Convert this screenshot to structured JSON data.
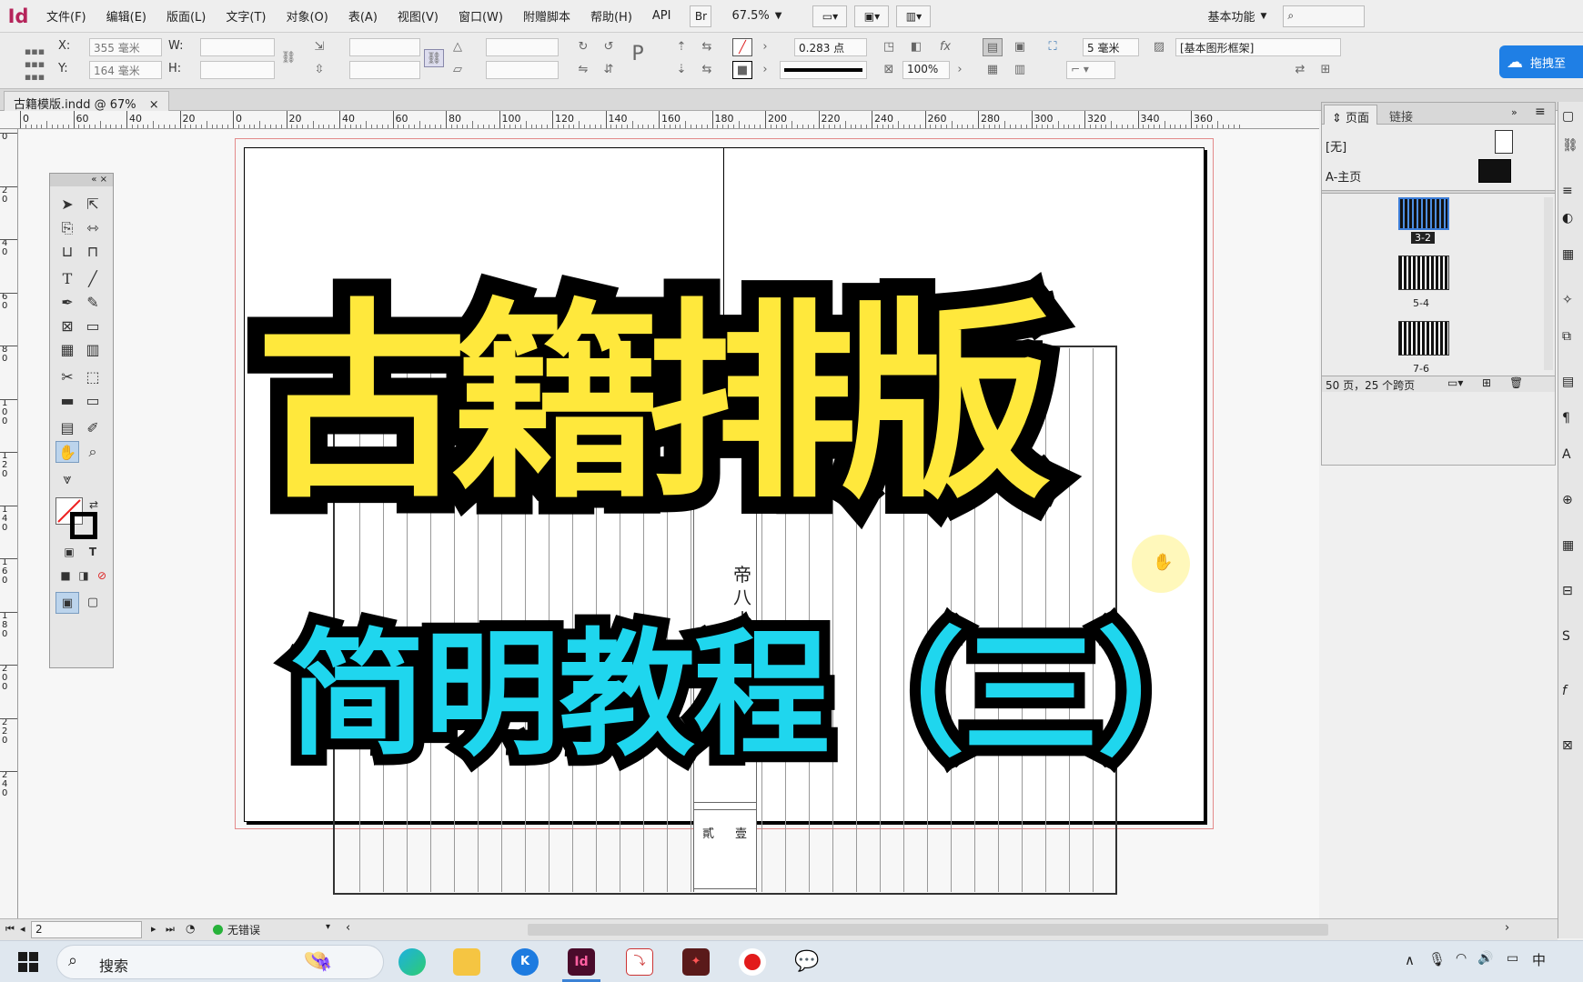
{
  "app": {
    "logo": "Id"
  },
  "menu": [
    "文件(F)",
    "编辑(E)",
    "版面(L)",
    "文字(T)",
    "对象(O)",
    "表(A)",
    "视图(V)",
    "窗口(W)",
    "附赠脚本",
    "帮助(H)",
    "API"
  ],
  "menubar_right": {
    "bridge": "Br",
    "zoom": "67.5%",
    "workspace": "基本功能",
    "search_placeholder": ""
  },
  "control": {
    "x_label": "X:",
    "x_value": "355 毫米",
    "y_label": "Y:",
    "y_value": "164 毫米",
    "w_label": "W:",
    "h_label": "H:",
    "stroke_weight": "0.283 点",
    "scale": "100%",
    "offset": "5 毫米",
    "style": "[基本图形框架]",
    "cloud": "拖拽至"
  },
  "doc_tab": {
    "title": "古籍模版.indd @ 67%",
    "close": "×"
  },
  "ruler": {
    "h_labels": [
      "0",
      "60",
      "40",
      "20",
      "0",
      "20",
      "40",
      "60",
      "80",
      "100",
      "120",
      "140",
      "160",
      "180",
      "200",
      "220",
      "240",
      "260",
      "280",
      "300",
      "320",
      "340",
      "360"
    ],
    "v_labels": [
      "0",
      "2\n0",
      "4\n0",
      "6\n0",
      "8\n0",
      "1\n0\n0",
      "1\n2\n0",
      "1\n4\n0",
      "1\n6\n0",
      "1\n8\n0",
      "2\n0\n0",
      "2\n2\n0",
      "2\n4\n0"
    ]
  },
  "document": {
    "title_line1": "古籍排版",
    "title_line2": "简明教程（三）",
    "banxin_text": [
      "帝",
      "八",
      "十"
    ],
    "page_nums": [
      "貳",
      "壹"
    ]
  },
  "pages_panel": {
    "tab_pages": "页面",
    "tab_links": "链接",
    "master_none": "[无]",
    "master_a": "A-主页",
    "spreads": [
      "3-2",
      "5-4",
      "7-6"
    ],
    "footer": "50 页，25 个跨页"
  },
  "status": {
    "page": "2",
    "errors": "无错误"
  },
  "taskbar": {
    "search": "搜索",
    "tray": "中"
  },
  "colors": {
    "title_fill": "#ffe83c",
    "subtitle_fill": "#1fd6ee",
    "bleed_guide": "#e36a6a"
  }
}
